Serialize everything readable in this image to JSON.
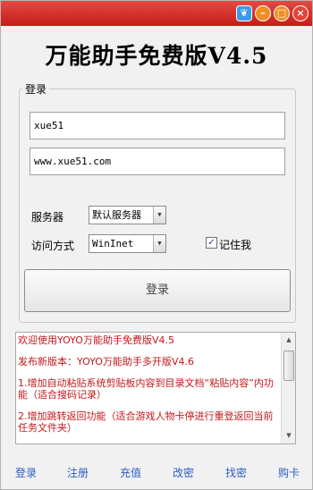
{
  "window": {
    "title": "万能助手免费版V4.5",
    "controls": [
      "skin-icon",
      "minimize-icon",
      "maximize-icon",
      "close-icon"
    ]
  },
  "login": {
    "group_label": "登录",
    "username": "xue51",
    "url": "www.xue51.com",
    "server_label": "服务器",
    "server_value": "默认服务器",
    "access_label": "访问方式",
    "access_value": "WinInet",
    "remember_label": "记住我",
    "remember_checked": true,
    "submit_label": "登录"
  },
  "news": {
    "lines": [
      "欢迎使用YOYO万能助手免费版V4.5",
      "发布新版本：YOYO万能助手多开版V4.6",
      "1.增加自动粘贴系统剪贴板内容到目录文档“粘贴内容”内功能（适合搜码记录）",
      "2.增加跳转返回功能（适合游戏人物卡停进行重登返回当前任务文件夹）"
    ]
  },
  "nav": {
    "items": [
      "登录",
      "注册",
      "充值",
      "改密",
      "找密",
      "购卡"
    ]
  },
  "colors": {
    "titlebar": "#d6322c",
    "news_text": "#c4171b",
    "link": "#2c5fbf"
  }
}
